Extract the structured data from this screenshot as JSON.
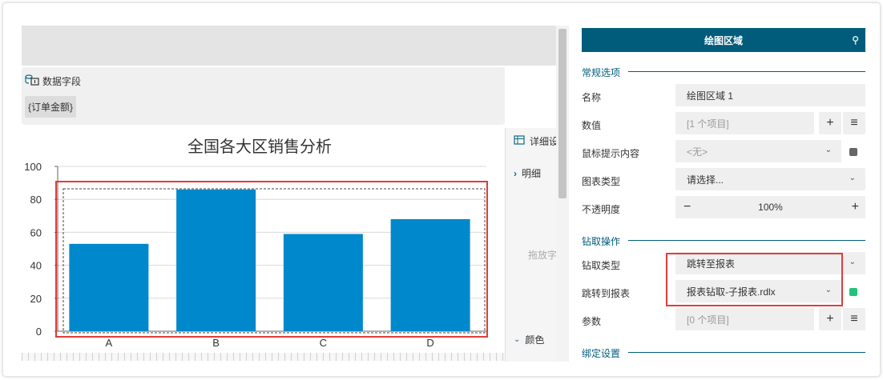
{
  "fields": {
    "title": "数据字段",
    "chip": "{订单金额}"
  },
  "strip": {
    "detail": "详细设",
    "detail_item": "明细",
    "hint": "拖放字",
    "color": "颜色"
  },
  "chart_data": {
    "type": "bar",
    "title": "全国各大区销售分析",
    "categories": [
      "A",
      "B",
      "C",
      "D"
    ],
    "values": [
      53,
      86,
      59,
      68
    ],
    "ylim": [
      0,
      100
    ],
    "yticks": [
      0,
      20,
      40,
      60,
      80,
      100
    ],
    "bar_color": "#0088cc",
    "grid": true
  },
  "props": {
    "header": "绘图区域",
    "sections": {
      "general": "常规选项",
      "drill": "钻取操作",
      "binding": "绑定设置"
    },
    "rows": {
      "name": {
        "label": "名称",
        "value": "绘图区域 1"
      },
      "value": {
        "label": "数值",
        "value": "[1 个项目]"
      },
      "tooltip": {
        "label": "鼠标提示内容",
        "value": "<无>"
      },
      "chart_type": {
        "label": "图表类型",
        "value": "请选择..."
      },
      "opacity": {
        "label": "不透明度",
        "value": "100%"
      },
      "drill_type": {
        "label": "钻取类型",
        "value": "跳转至报表"
      },
      "jump_report": {
        "label": "跳转到报表",
        "value": "报表钻取-子报表.rdlx"
      },
      "params": {
        "label": "参数",
        "value": "[0 个项目]"
      }
    },
    "colors": {
      "accent": "#015c7c",
      "highlight": "#e03c3c",
      "green": "#22c27a",
      "gray_dot": "#666666"
    }
  }
}
